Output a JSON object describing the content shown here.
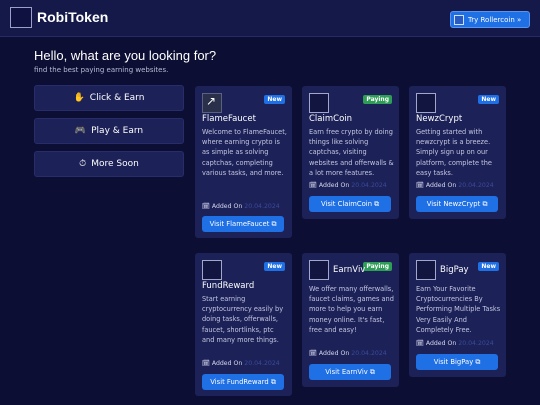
{
  "brand": {
    "name": "RobiToken"
  },
  "header": {
    "try_button": "Try Rollercoin  »"
  },
  "hero": {
    "title": "Hello, what are you looking for?",
    "subtitle": "find the best paying earning websites."
  },
  "sidebar": {
    "items": [
      {
        "label": "Click & Earn",
        "icon": "✋"
      },
      {
        "label": "Play & Earn",
        "icon": "🎮"
      },
      {
        "label": "More Soon",
        "icon": "⏱"
      }
    ]
  },
  "cards": [
    {
      "title": "FlameFaucet",
      "badge": "New",
      "desc": "Welcome to FlameFaucet, where earning crypto is as simple as solving captchas, completing various tasks, and more.",
      "added_label": "Added On",
      "date": "20.04.2024",
      "visit": "Visit FlameFaucet ⧉"
    },
    {
      "title": "ClaimCoin",
      "badge": "Paying",
      "desc": "Earn free crypto by doing things like solving captchas, visiting websites and offerwalls & a lot more features.",
      "added_label": "Added On",
      "date": "20.04.2024",
      "visit": "Visit ClaimCoin ⧉"
    },
    {
      "title": "NewzCrypt",
      "badge": "New",
      "desc": "Getting started with newzcrypt is a breeze. Simply sign up on our platform, complete the easy tasks.",
      "added_label": "Added On",
      "date": "20.04.2024",
      "visit": "Visit NewzCrypt ⧉"
    },
    {
      "title": "FundReward",
      "badge": "New",
      "desc": "Start earning cryptocurrency easily by doing tasks, offerwalls, faucet, shortlinks, ptc and many more things.",
      "added_label": "Added On",
      "date": "20.04.2024",
      "visit": "Visit FundReward ⧉"
    },
    {
      "title": "EarnViv",
      "badge": "Paying",
      "desc": "We offer many offerwalls, faucet claims, games and more to help you earn money online. It's fast, free and easy!",
      "added_label": "Added On",
      "date": "20.04.2024",
      "visit": "Visit EarnViv ⧉"
    },
    {
      "title": "BigPay",
      "badge": "New",
      "desc": "Earn Your Favorite Cryptocurrencies By Performing Multiple Tasks Very Easily And Completely Free.",
      "added_label": "Added On",
      "date": "20.04.2024",
      "visit": "Visit BigPay ⧉"
    }
  ],
  "colors": {
    "accent": "#1f6fe5",
    "paying": "#2e9e57",
    "background": "#0c0f33",
    "card": "#1c2158"
  }
}
